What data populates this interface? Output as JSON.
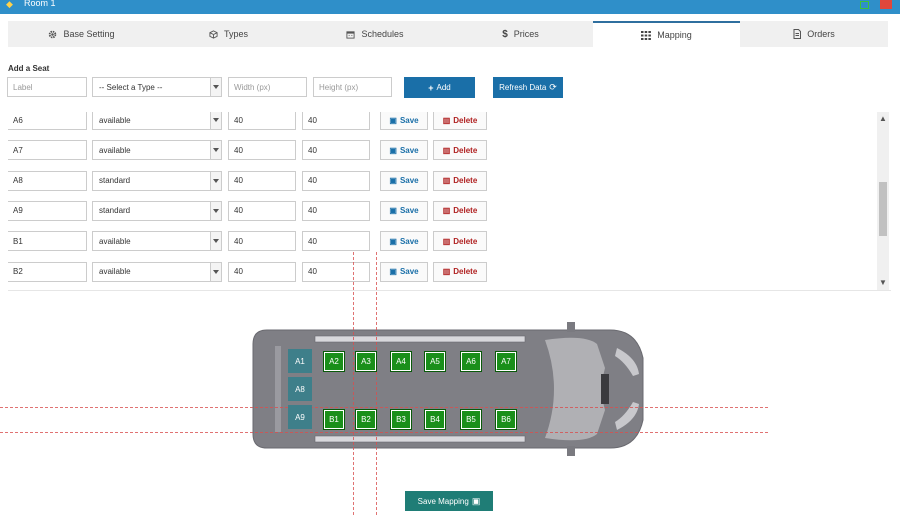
{
  "window": {
    "title": "Room 1"
  },
  "tabs": [
    {
      "label": "Base Setting",
      "icon": "gear-icon"
    },
    {
      "label": "Types",
      "icon": "cube-icon"
    },
    {
      "label": "Schedules",
      "icon": "calendar-icon"
    },
    {
      "label": "Prices",
      "icon": "dollar-icon"
    },
    {
      "label": "Mapping",
      "icon": "grid-icon"
    },
    {
      "label": "Orders",
      "icon": "document-icon"
    }
  ],
  "active_tab": "Mapping",
  "add_seat": {
    "heading": "Add a Seat",
    "label_placeholder": "Label",
    "type_selected": "-- Select a Type --",
    "width_placeholder": "Width (px)",
    "height_placeholder": "Height (px)",
    "add_label": "Add",
    "refresh_label": "Refresh Data"
  },
  "seat_rows": [
    {
      "label": "A6",
      "type": "available",
      "width": "40",
      "height": "40"
    },
    {
      "label": "A7",
      "type": "available",
      "width": "40",
      "height": "40"
    },
    {
      "label": "A8",
      "type": "standard",
      "width": "40",
      "height": "40"
    },
    {
      "label": "A9",
      "type": "standard",
      "width": "40",
      "height": "40"
    },
    {
      "label": "B1",
      "type": "available",
      "width": "40",
      "height": "40"
    },
    {
      "label": "B2",
      "type": "available",
      "width": "40",
      "height": "40"
    }
  ],
  "row_actions": {
    "save": "Save",
    "delete": "Delete"
  },
  "map": {
    "standard_seats": [
      "A1",
      "A8",
      "A9"
    ],
    "top_row": [
      "A2",
      "A3",
      "A4",
      "A5",
      "A6",
      "A7"
    ],
    "bottom_row": [
      "B1",
      "B2",
      "B3",
      "B4",
      "B5",
      "B6"
    ]
  },
  "save_mapping_label": "Save Mapping",
  "colors": {
    "accent": "#1a6fa8",
    "seat_available": "#1a8f1a",
    "seat_standard": "#3e7f8a",
    "save_mapping": "#1f7d76",
    "delete": "#b02020"
  }
}
